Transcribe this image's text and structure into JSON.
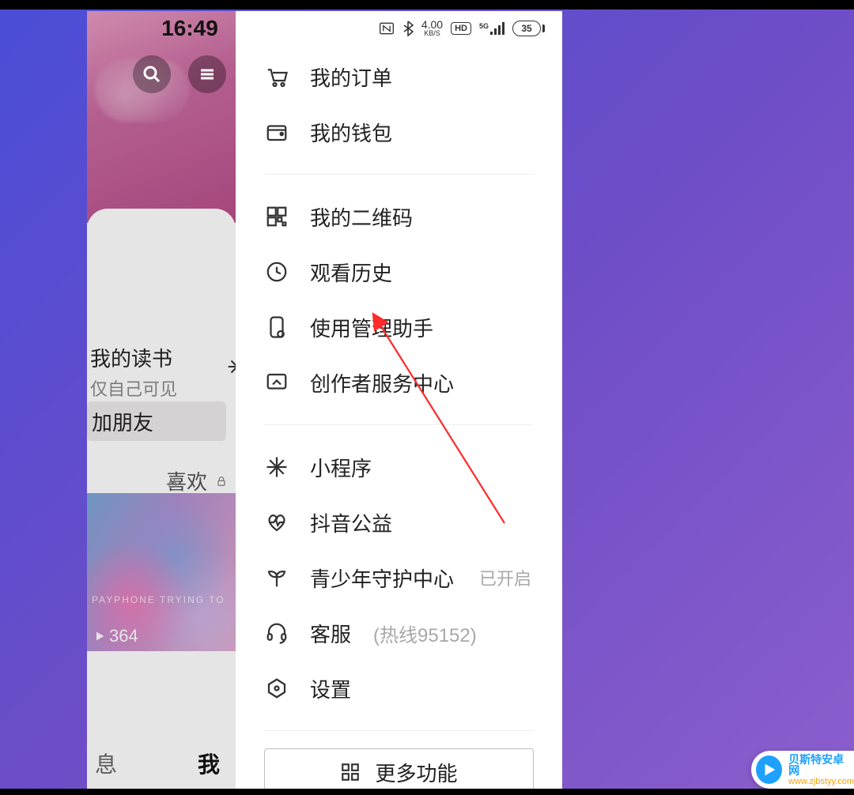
{
  "status_bar": {
    "time": "16:49",
    "net_speed": "4.00",
    "net_unit": "KB/S",
    "hd_label": "HD",
    "five_g": "5G",
    "battery_pct": "35"
  },
  "back_page": {
    "reading_title": "我的读书",
    "reading_sub": "仅自己可见",
    "add_friend_label": "加朋友",
    "like_tab": "喜欢",
    "thumb_play_count": "364",
    "thumb_watermark": "PAYPHONE TRYING TO",
    "bottom_tab_msg": "息",
    "bottom_tab_me": "我"
  },
  "drawer": {
    "items": [
      {
        "label": "我的订单",
        "icon": "cart-icon"
      },
      {
        "label": "我的钱包",
        "icon": "wallet-icon"
      }
    ],
    "items2": [
      {
        "label": "我的二维码",
        "icon": "qr-icon"
      },
      {
        "label": "观看历史",
        "icon": "clock-icon"
      },
      {
        "label": "使用管理助手",
        "icon": "device-icon"
      },
      {
        "label": "创作者服务中心",
        "icon": "display-icon"
      }
    ],
    "items3": [
      {
        "label": "小程序",
        "icon": "spark-icon"
      },
      {
        "label": "抖音公益",
        "icon": "heart-icon"
      },
      {
        "label": "青少年守护中心",
        "icon": "sprout-icon",
        "sub": "已开启"
      },
      {
        "label": "客服",
        "icon": "headset-icon",
        "hotline": "(热线95152)"
      },
      {
        "label": "设置",
        "icon": "hex-icon"
      }
    ],
    "more_label": "更多功能"
  },
  "watermark": {
    "name": "贝斯特安卓网",
    "url": "www.zjbstyy.com"
  }
}
